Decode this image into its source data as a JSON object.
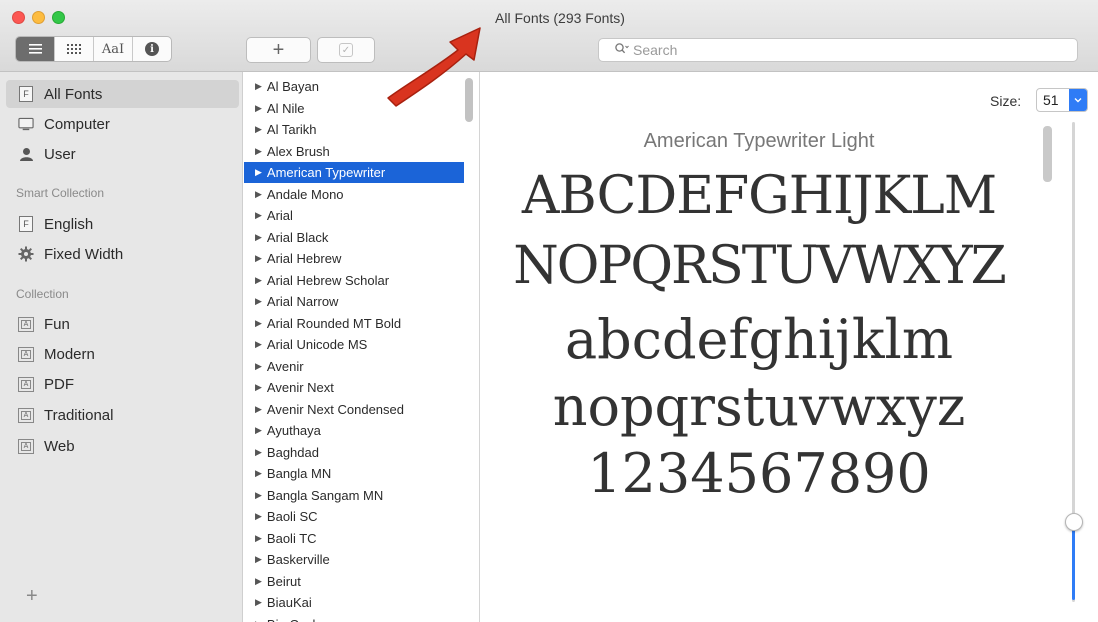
{
  "window": {
    "title": "All Fonts (293 Fonts)"
  },
  "toolbar": {
    "view_buttons": [
      {
        "name": "list-view",
        "icon": "list-icon",
        "active": true
      },
      {
        "name": "grid-view",
        "icon": "grid-icon",
        "active": false
      },
      {
        "name": "sample-view",
        "label": "AaI",
        "active": false
      },
      {
        "name": "info-view",
        "icon": "info-icon",
        "active": false
      }
    ],
    "add_label": "+",
    "check_label": "✓",
    "search": {
      "placeholder": "Search"
    }
  },
  "sidebar": {
    "library_items": [
      {
        "label": "All Fonts",
        "icon": "font-file-icon",
        "selected": true
      },
      {
        "label": "Computer",
        "icon": "computer-icon",
        "selected": false
      },
      {
        "label": "User",
        "icon": "user-icon",
        "selected": false
      }
    ],
    "smart_collection_header": "Smart Collection",
    "smart_items": [
      {
        "label": "English",
        "icon": "font-file-icon"
      },
      {
        "label": "Fixed Width",
        "icon": "gear-icon"
      }
    ],
    "collection_header": "Collection",
    "collection_items": [
      {
        "label": "Fun",
        "icon": "collection-icon"
      },
      {
        "label": "Modern",
        "icon": "collection-icon"
      },
      {
        "label": "PDF",
        "icon": "collection-icon"
      },
      {
        "label": "Traditional",
        "icon": "collection-icon"
      },
      {
        "label": "Web",
        "icon": "collection-icon"
      }
    ],
    "add_label": "+"
  },
  "font_list": {
    "selected_index": 4,
    "items": [
      "Al Bayan",
      "Al Nile",
      "Al Tarikh",
      "Alex Brush",
      "American Typewriter",
      "Andale Mono",
      "Arial",
      "Arial Black",
      "Arial Hebrew",
      "Arial Hebrew Scholar",
      "Arial Narrow",
      "Arial Rounded MT Bold",
      "Arial Unicode MS",
      "Avenir",
      "Avenir Next",
      "Avenir Next Condensed",
      "Ayuthaya",
      "Baghdad",
      "Bangla MN",
      "Bangla Sangam MN",
      "Baoli SC",
      "Baoli TC",
      "Baskerville",
      "Beirut",
      "BiauKai",
      "Big Caslon"
    ]
  },
  "preview": {
    "size_label": "Size:",
    "size_value": "51",
    "font_name": "American Typewriter Light",
    "sample_lines": [
      "ABCDEFGHIJKLM",
      "NOPQRSTUVWXYZ",
      "abcdefghijklm",
      "nopqrstuvwxyz",
      "1234567890"
    ],
    "slider_level": 0.17
  },
  "colors": {
    "selection": "#1b64d8",
    "accent": "#2f7cf6",
    "annotation_arrow": "#d9341f"
  }
}
